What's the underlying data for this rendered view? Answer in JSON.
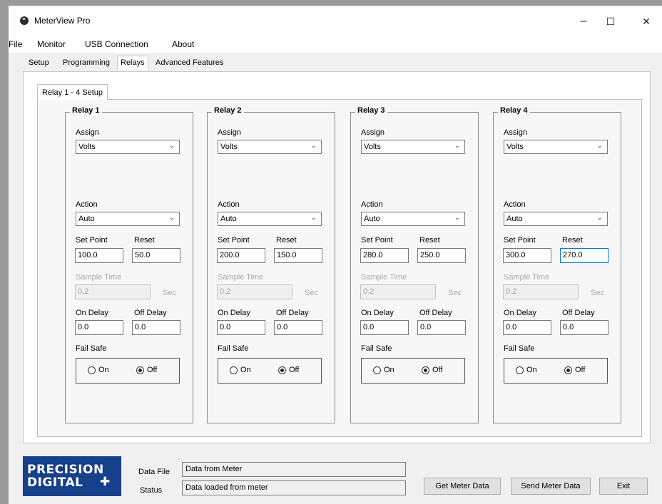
{
  "window": {
    "title": "MeterView Pro",
    "controls": {
      "minimize": "–",
      "maximize": "☐",
      "close": "✕"
    }
  },
  "menu": [
    "File",
    "Monitor",
    "USB Connection",
    "About"
  ],
  "tabs": [
    "Setup",
    "Programming",
    "Relays",
    "Advanced Features"
  ],
  "active_tab": "Relays",
  "subtab": "Relay 1 - 4 Setup",
  "labels": {
    "assign": "Assign",
    "action": "Action",
    "set_point": "Set Point",
    "reset": "Reset",
    "sample_time": "Sample Time",
    "sec": "Sec",
    "on_delay": "On Delay",
    "off_delay": "Off Delay",
    "fail_safe": "Fail Safe",
    "on": "On",
    "off": "Off"
  },
  "relays": [
    {
      "title": "Relay 1",
      "assign": "Volts",
      "action": "Auto",
      "set_point": "100.0",
      "reset": "50.0",
      "sample_time": "0.2",
      "on_delay": "0.0",
      "off_delay": "0.0",
      "fail_safe": "Off"
    },
    {
      "title": "Relay 2",
      "assign": "Volts",
      "action": "Auto",
      "set_point": "200.0",
      "reset": "150.0",
      "sample_time": "0.2",
      "on_delay": "0.0",
      "off_delay": "0.0",
      "fail_safe": "Off"
    },
    {
      "title": "Relay 3",
      "assign": "Volts",
      "action": "Auto",
      "set_point": "280.0",
      "reset": "250.0",
      "sample_time": "0.2",
      "on_delay": "0.0",
      "off_delay": "0.0",
      "fail_safe": "Off"
    },
    {
      "title": "Relay 4",
      "assign": "Volts",
      "action": "Auto",
      "set_point": "300.0",
      "reset": "270.0",
      "sample_time": "0.2",
      "on_delay": "0.0",
      "off_delay": "0.0",
      "fail_safe": "Off"
    }
  ],
  "footer": {
    "logo_line1": "PRECISION",
    "logo_line2": "DIGITAL",
    "logo_mark": "✚",
    "data_file_label": "Data File",
    "data_file_value": "Data from Meter",
    "status_label": "Status",
    "status_value": "Data loaded from meter",
    "buttons": {
      "get": "Get Meter Data",
      "send": "Send Meter Data",
      "exit": "Exit"
    }
  }
}
